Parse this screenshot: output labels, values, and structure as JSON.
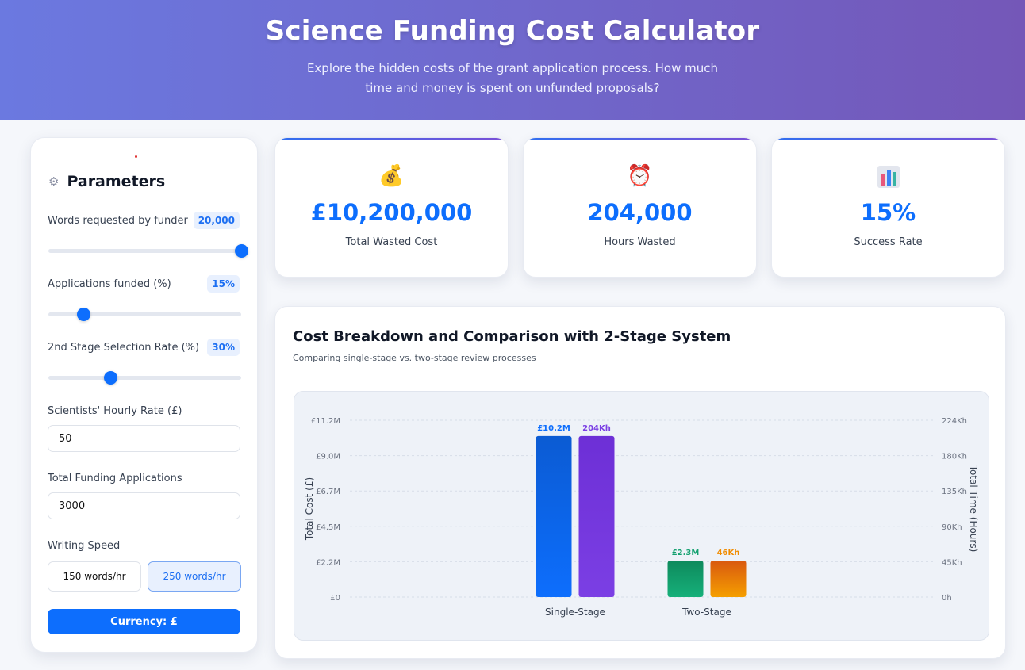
{
  "header": {
    "title": "Science Funding Cost Calculator",
    "subtitle": "Explore the hidden costs of the grant application process. How much time and money is spent on unfunded proposals?"
  },
  "params": {
    "title": "Parameters",
    "words": {
      "label": "Words requested by funder",
      "value": "20,000",
      "fraction": 1.0
    },
    "funded": {
      "label": "Applications funded (%)",
      "value": "15%",
      "fraction": 0.18
    },
    "second": {
      "label": "2nd Stage Selection Rate (%)",
      "value": "30%",
      "fraction": 0.32
    },
    "rate": {
      "label": "Scientists' Hourly Rate (£)",
      "value": "50"
    },
    "apps": {
      "label": "Total Funding Applications",
      "value": "3000"
    },
    "speed": {
      "label": "Writing Speed",
      "option_a": "150 words/hr",
      "option_b": "250 words/hr",
      "selected": "250 words/hr"
    },
    "currency_button": "Currency: £"
  },
  "stats": [
    {
      "icon": "money-bag-icon",
      "value": "£10,200,000",
      "label": "Total Wasted Cost"
    },
    {
      "icon": "alarm-clock-icon",
      "value": "204,000",
      "label": "Hours Wasted"
    },
    {
      "icon": "bar-chart-icon",
      "value": "15%",
      "label": "Success Rate"
    }
  ],
  "chart": {
    "title": "Cost Breakdown and Comparison with 2-Stage System",
    "subtitle": "Comparing single-stage vs. two-stage review processes"
  },
  "chart_data": {
    "type": "bar",
    "categories": [
      "Single-Stage",
      "Two-Stage"
    ],
    "series": [
      {
        "axis": "left",
        "values": [
          10.2,
          2.3
        ],
        "labels": [
          "£10.2M",
          "£2.3M"
        ]
      },
      {
        "axis": "right",
        "values": [
          204,
          46
        ],
        "labels": [
          "204Kh",
          "46Kh"
        ]
      }
    ],
    "ylabel": "Total Cost (£)",
    "y2label": "Total Time (Hours)",
    "ylim": [
      0,
      11.2
    ],
    "y2lim": [
      0,
      224
    ],
    "yticks": [
      "£0",
      "£2.2M",
      "£4.5M",
      "£6.7M",
      "£9.0M",
      "£11.2M"
    ],
    "y2ticks": [
      "0h",
      "45Kh",
      "90Kh",
      "135Kh",
      "180Kh",
      "224Kh"
    ],
    "grid": true,
    "colors": {
      "cost_single": "#0d6efd",
      "time_single": "#7b3fe4",
      "cost_two": "#12a06e",
      "time_two": "#f08c00"
    }
  }
}
